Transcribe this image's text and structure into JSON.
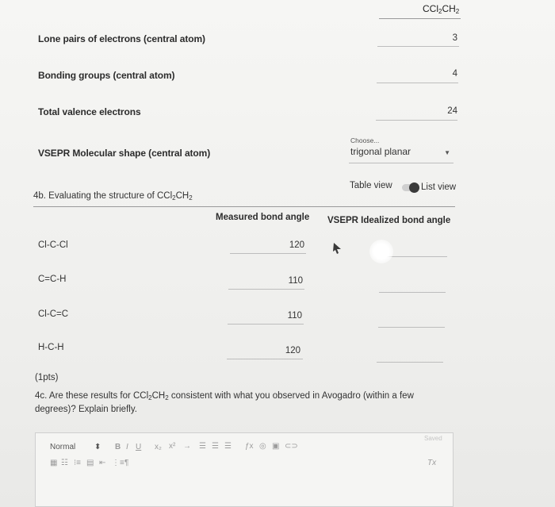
{
  "header": {
    "formula_main": "CCl",
    "formula_sub1": "2",
    "formula_mid": "CH",
    "formula_sub2": "2"
  },
  "rows": [
    {
      "label": "Lone pairs of electrons (central atom)",
      "value": "3"
    },
    {
      "label": "Bonding groups (central atom)",
      "value": "4"
    },
    {
      "label": "Total valence electrons",
      "value": "24"
    }
  ],
  "vsepr": {
    "label": "VSEPR Molecular shape (central atom)",
    "hint": "Choose...",
    "selected": "trigonal planar"
  },
  "view_toggle": {
    "table_label": "Table view",
    "list_label": "List view"
  },
  "section4b": {
    "title_prefix": "4b. Evaluating the structure of CCl",
    "title_sub1": "2",
    "title_mid": "CH",
    "title_sub2": "2"
  },
  "table": {
    "col_measured": "Measured bond angle",
    "col_vsepr": "VSEPR Idealized bond angle",
    "rows": [
      {
        "bond": "Cl-C-Cl",
        "measured": "120",
        "ideal": ""
      },
      {
        "bond": "C=C-H",
        "measured": "110",
        "ideal": ""
      },
      {
        "bond": "Cl-C=C",
        "measured": "110",
        "ideal": ""
      },
      {
        "bond": "H-C-H",
        "measured": "120",
        "ideal": ""
      }
    ]
  },
  "section4c": {
    "points": "(1pts)",
    "q_prefix": "4c. Are these results for CCl",
    "q_sub1": "2",
    "q_mid": "CH",
    "q_sub2": "2",
    "q_suffix": " consistent with what you observed in Avogadro (within a few",
    "q_line2": "degrees)? Explain briefly."
  },
  "editor": {
    "style_select": "Normal",
    "bold": "B",
    "italic": "I",
    "underline": "U",
    "saved": "Saved"
  }
}
